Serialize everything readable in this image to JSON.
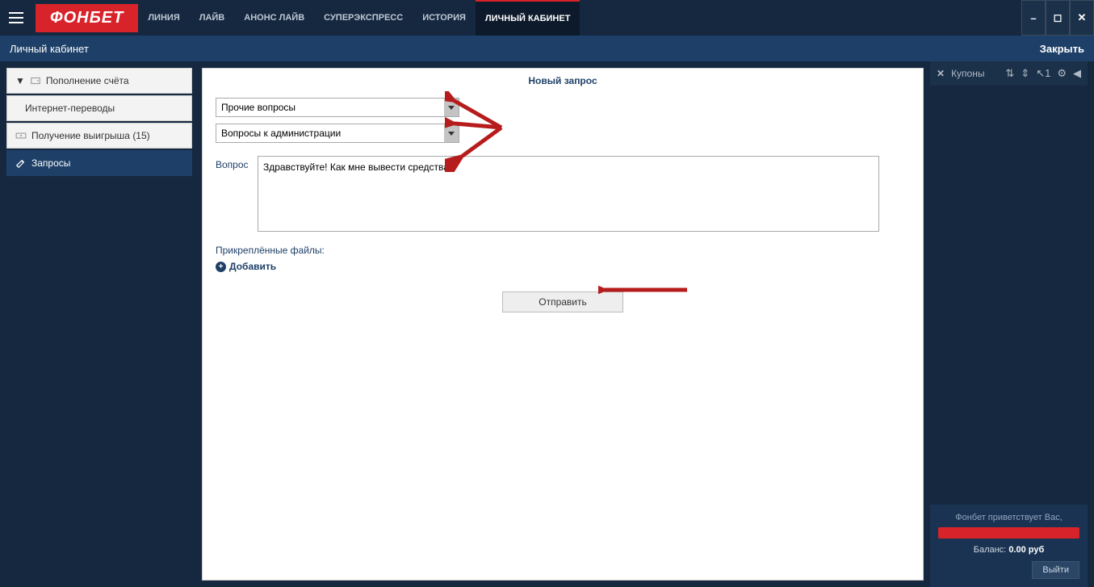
{
  "brand": "ФОНБЕТ",
  "nav": {
    "items": [
      "ЛИНИЯ",
      "ЛАЙВ",
      "АНОНС ЛАЙВ",
      "СУПЕРЭКСПРЕСС",
      "ИСТОРИЯ",
      "ЛИЧНЫЙ КАБИНЕТ"
    ],
    "active_index": 5
  },
  "subbar": {
    "title": "Личный кабинет",
    "close": "Закрыть"
  },
  "sidebar": {
    "items": [
      {
        "label": "Пополнение счёта",
        "expanded": true
      },
      {
        "label": "Интернет-переводы",
        "sub": true
      },
      {
        "label": "Получение выигрыша (15)"
      },
      {
        "label": "Запросы",
        "active": true
      }
    ]
  },
  "form": {
    "title": "Новый запрос",
    "select1": "Прочие вопросы",
    "select2": "Вопросы к администрации",
    "question_label": "Вопрос",
    "question_value": "Здравствуйте! Как мне вывести средства?",
    "attachments_label": "Прикреплённые файлы:",
    "add_label": "Добавить",
    "submit": "Отправить"
  },
  "coupons": {
    "label": "Купоны"
  },
  "account": {
    "greeting": "Фонбет приветствует Вас,",
    "balance_label": "Баланс:",
    "balance_value": "0.00 руб",
    "logout": "Выйти"
  }
}
